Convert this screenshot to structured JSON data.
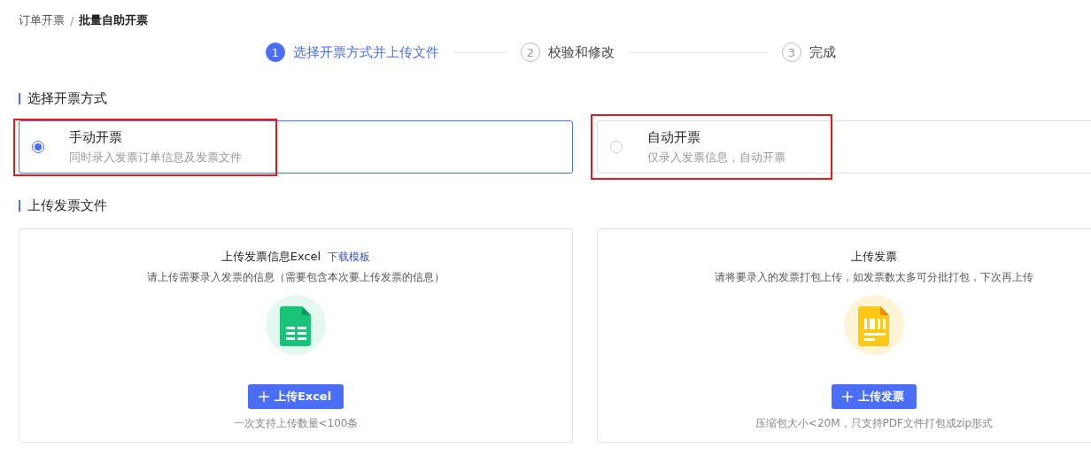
{
  "breadcrumb": [
    {
      "label": "订单开票",
      "current": false
    },
    {
      "label": "批量自助开票",
      "current": true
    }
  ],
  "breadcrumb_separator": "/",
  "steps": [
    {
      "number": "1",
      "label": "选择开票方式并上传文件",
      "selected": true
    },
    {
      "number": "2",
      "label": "校验和修改",
      "selected": false
    },
    {
      "number": "3",
      "label": "完成",
      "selected": false
    }
  ],
  "method_section": {
    "title": "选择开票方式",
    "options": [
      {
        "title": "手动开票",
        "description": "同时录入发票订单信息及发票文件",
        "selected": true,
        "highlighted": true
      },
      {
        "title": "自动开票",
        "description": "仅录入发票信息，自动开票",
        "selected": false,
        "highlighted": true
      }
    ]
  },
  "upload_section": {
    "title": "上传发票文件",
    "cards": [
      {
        "kind": "excel",
        "title": "上传发票信息Excel",
        "link": "下载模板",
        "description": "请上传需要录入发票的信息（需要包含本次要上传发票的信息）",
        "button": "上传Excel",
        "note": "一次支持上传数量<100条"
      },
      {
        "kind": "invoice",
        "title": "上传发票",
        "description": "请将要录入的发票打包上传，如发票数太多可分批打包，下次再上传",
        "button": "上传发票",
        "note": "压缩包大小<20M，只支持PDF文件打包成zip形式"
      }
    ]
  }
}
